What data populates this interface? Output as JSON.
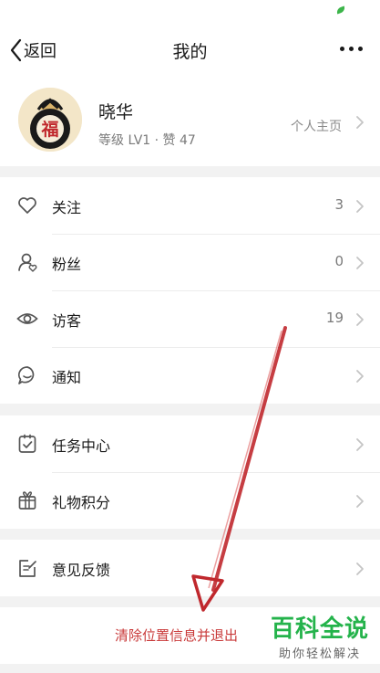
{
  "nav": {
    "back_label": "返回",
    "title": "我的",
    "more_icon": "more-dots-icon"
  },
  "profile": {
    "name": "晓华",
    "meta": "等级 LV1 · 赞 47",
    "link_label": "个人主页",
    "avatar_glyph": "福"
  },
  "menu_group_1": [
    {
      "label": "关注",
      "count": "3",
      "icon": "heart-icon"
    },
    {
      "label": "粉丝",
      "count": "0",
      "icon": "fans-icon"
    },
    {
      "label": "访客",
      "count": "19",
      "icon": "eye-icon"
    },
    {
      "label": "通知",
      "count": "",
      "icon": "chat-bubble-icon"
    }
  ],
  "menu_group_2": [
    {
      "label": "任务中心",
      "icon": "clipboard-check-icon"
    },
    {
      "label": "礼物积分",
      "icon": "gift-icon"
    }
  ],
  "menu_group_3": [
    {
      "label": "意见反馈",
      "icon": "edit-note-icon"
    }
  ],
  "footer": {
    "clear_label": "清除位置信息并退出"
  },
  "watermark": {
    "title": "百科全说",
    "subtitle": "助你轻松解决"
  },
  "colors": {
    "accent_red": "#c93a3a",
    "watermark_green": "#24b34b",
    "annotation_arrow": "#c0282d"
  }
}
